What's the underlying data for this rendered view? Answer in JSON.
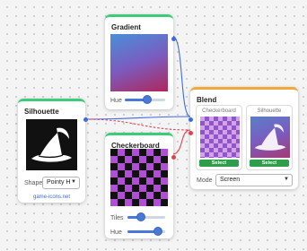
{
  "colors": {
    "accent_green": "#3ecb79",
    "accent_orange": "#f2a93b",
    "wire_blue": "#3c6be0",
    "wire_red": "#e2414f",
    "slider_blue": "#4a78d8",
    "select_green": "#2f9e4b"
  },
  "gradient_node": {
    "title": "Gradient",
    "hue_label": "Hue",
    "hue_value": 0.55
  },
  "silhouette_node": {
    "title": "Silhouette",
    "shape_label": "Shape",
    "shape_value": "Pointy H",
    "source_link": "game-icons.net",
    "icon": "wizard-hat-icon"
  },
  "checkerboard_node": {
    "title": "Checkerboard",
    "tiles_label": "Tiles",
    "tiles_value": 0.35,
    "hue_label": "Hue",
    "hue_value": 0.8
  },
  "blend_node": {
    "title": "Blend",
    "inputs": [
      {
        "label": "Checkerboard",
        "button": "Select"
      },
      {
        "label": "Silhouette",
        "button": "Select"
      }
    ],
    "mode_label": "Mode",
    "mode_value": "Screen"
  }
}
